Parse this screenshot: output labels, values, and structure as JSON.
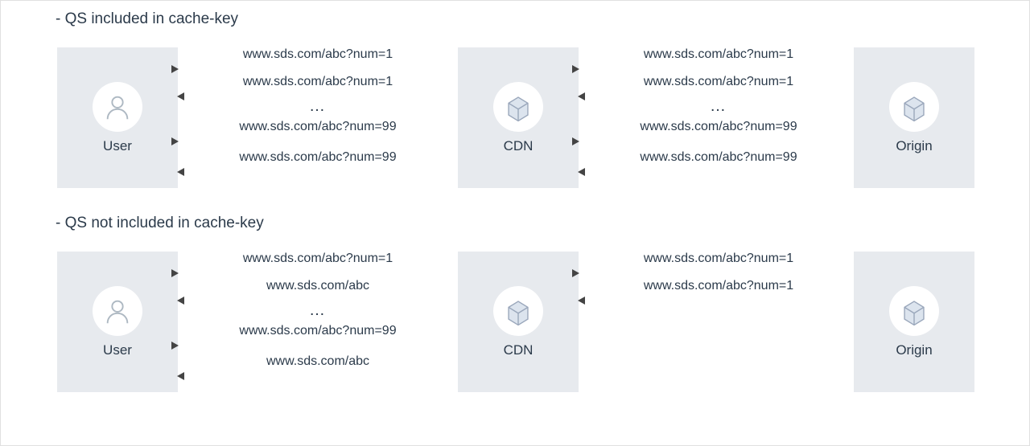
{
  "sections": [
    {
      "heading": "- QS included in cache-key",
      "user_label": "User",
      "cdn_label": "CDN",
      "origin_label": "Origin",
      "left_flows": {
        "r1": "www.sds.com/abc?num=1",
        "r2": "www.sds.com/abc?num=1",
        "r3": "www.sds.com/abc?num=99",
        "r4": "www.sds.com/abc?num=99",
        "dots": "…"
      },
      "right_flows": {
        "r1": "www.sds.com/abc?num=1",
        "r2": "www.sds.com/abc?num=1",
        "r3": "www.sds.com/abc?num=99",
        "r4": "www.sds.com/abc?num=99",
        "dots": "…"
      }
    },
    {
      "heading": "- QS not included in cache-key",
      "user_label": "User",
      "cdn_label": "CDN",
      "origin_label": "Origin",
      "left_flows": {
        "r1": "www.sds.com/abc?num=1",
        "r2": "www.sds.com/abc",
        "r3": "www.sds.com/abc?num=99",
        "r4": "www.sds.com/abc",
        "dots": "…"
      },
      "right_flows": {
        "r1": "www.sds.com/abc?num=1",
        "r2": "www.sds.com/abc?num=1"
      }
    }
  ]
}
